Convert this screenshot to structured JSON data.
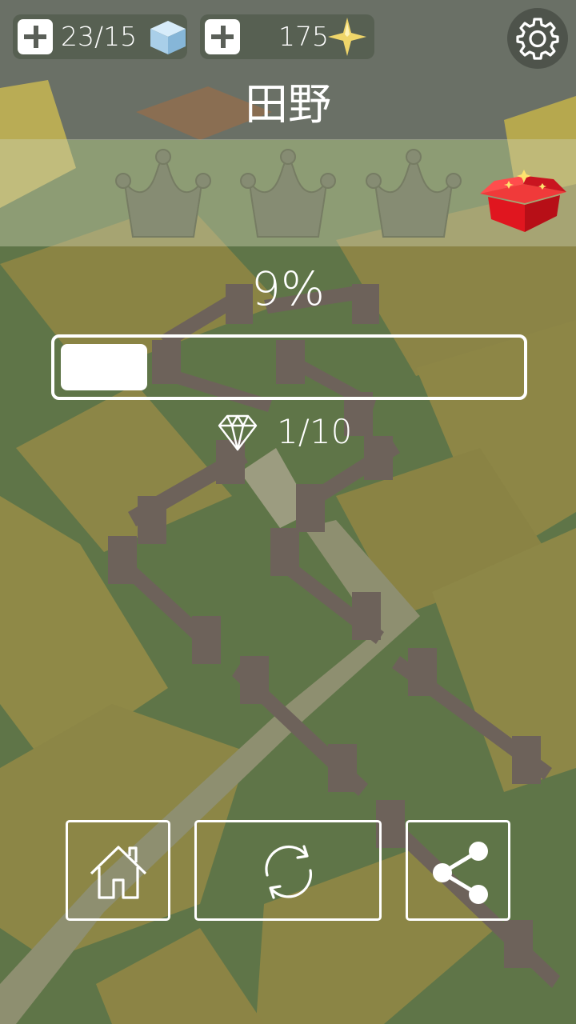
{
  "top_bar": {
    "cubes": {
      "value": "23/15",
      "icon": "cube-icon"
    },
    "stars": {
      "value": "175",
      "icon": "sparkle-star-icon"
    },
    "settings_icon": "gear-icon"
  },
  "level": {
    "title": "田野",
    "crowns": [
      {
        "earned": false,
        "icon": "crown-icon"
      },
      {
        "earned": false,
        "icon": "crown-icon"
      },
      {
        "earned": false,
        "icon": "crown-icon"
      }
    ],
    "reward_icon": "gift-box-icon"
  },
  "progress": {
    "label": "9%",
    "fraction": 0.09
  },
  "gems": {
    "icon": "diamond-icon",
    "count": "1/10"
  },
  "buttons": [
    {
      "name": "home-button",
      "icon": "home-icon"
    },
    {
      "name": "restart-button",
      "icon": "refresh-icon"
    },
    {
      "name": "share-button",
      "icon": "share-icon"
    }
  ],
  "colors": {
    "grass": "#5f7548",
    "field": "#8e8646",
    "fence": "#6d625a",
    "path": "#8e8f70",
    "gift_red": "#e0161f",
    "crown": "#868c73"
  }
}
